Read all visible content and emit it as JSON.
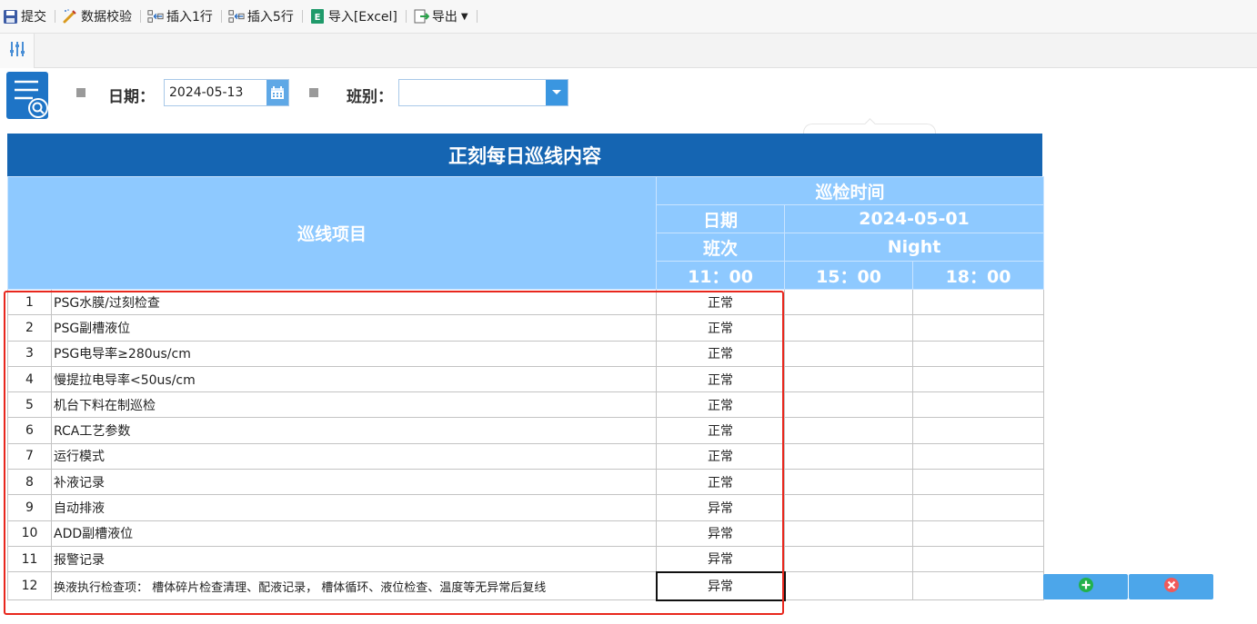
{
  "toolbar": {
    "submit": "提交",
    "validate": "数据校验",
    "insert1": "插入1行",
    "insert5": "插入5行",
    "import_excel": "导入[Excel]",
    "export": "导出"
  },
  "filters": {
    "date_label": "日期：",
    "date_value": "2024-05-13",
    "shift_label": "班别：",
    "shift_value": ""
  },
  "report": {
    "title": "正刻每日巡线内容",
    "item_header": "巡线项目",
    "time_header": "巡检时间",
    "date_label": "日期",
    "date_value": "2024-05-01",
    "shift_label": "班次",
    "shift_value": "Night",
    "times": [
      "11：00",
      "15：00",
      "18：00"
    ],
    "rows": [
      {
        "no": "1",
        "item": "PSG水膜/过刻检查",
        "v1": "正常",
        "v2": "",
        "v3": ""
      },
      {
        "no": "2",
        "item": "PSG副槽液位",
        "v1": "正常",
        "v2": "",
        "v3": ""
      },
      {
        "no": "3",
        "item": "PSG电导率≥280us/cm",
        "v1": "正常",
        "v2": "",
        "v3": ""
      },
      {
        "no": "4",
        "item": "慢提拉电导率<50us/cm",
        "v1": "正常",
        "v2": "",
        "v3": ""
      },
      {
        "no": "5",
        "item": "机台下料在制巡检",
        "v1": "正常",
        "v2": "",
        "v3": ""
      },
      {
        "no": "6",
        "item": "RCA工艺参数",
        "v1": "正常",
        "v2": "",
        "v3": ""
      },
      {
        "no": "7",
        "item": "运行模式",
        "v1": "正常",
        "v2": "",
        "v3": ""
      },
      {
        "no": "8",
        "item": "补液记录",
        "v1": "正常",
        "v2": "",
        "v3": ""
      },
      {
        "no": "9",
        "item": "自动排液",
        "v1": "异常",
        "v2": "",
        "v3": ""
      },
      {
        "no": "10",
        "item": "ADD副槽液位",
        "v1": "异常",
        "v2": "",
        "v3": ""
      },
      {
        "no": "11",
        "item": "报警记录",
        "v1": "异常",
        "v2": "",
        "v3": ""
      },
      {
        "no": "12",
        "item": "换液执行检查项： 槽体碎片检查清理、配液记录， 槽体循环、液位检查、温度等无异常后复线",
        "v1": "异常",
        "v2": "",
        "v3": ""
      }
    ]
  },
  "colors": {
    "title_bg": "#1565b2",
    "header_bg": "#8ec9ff",
    "highlight_border": "#e8271d",
    "add_icon": "#22b14c",
    "delete_icon": "#f05a5a"
  },
  "icons": [
    "save-icon",
    "validate-icon",
    "insert-row-icon",
    "excel-icon",
    "export-icon",
    "settings-sliders-icon",
    "query-icon",
    "calendar-icon",
    "dropdown-arrow-icon",
    "add-icon",
    "delete-icon"
  ]
}
